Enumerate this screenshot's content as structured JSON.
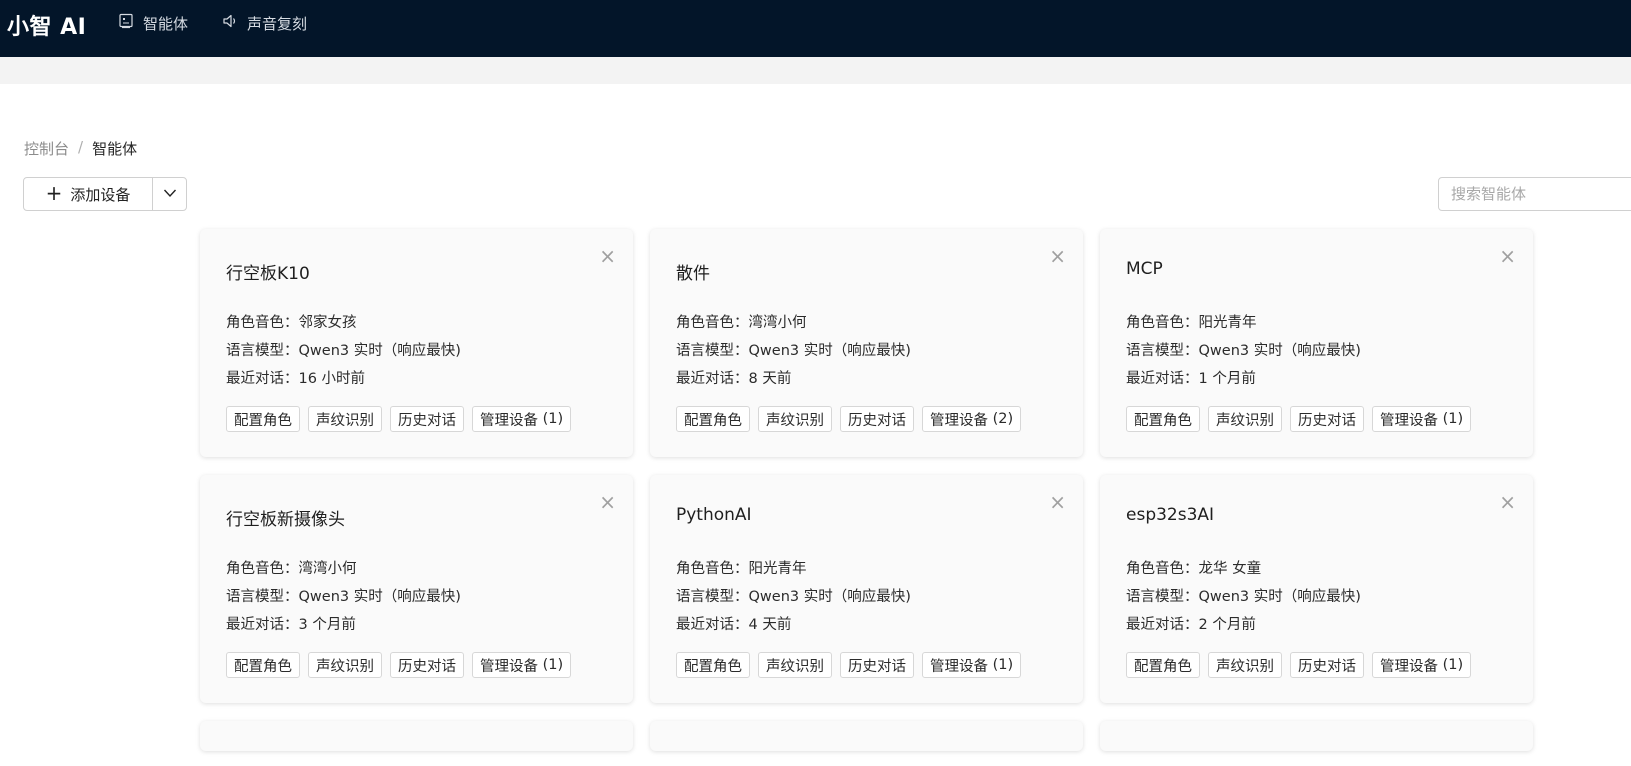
{
  "header": {
    "logo": "小智 AI",
    "nav": [
      {
        "label": "智能体",
        "icon": "robot-icon"
      },
      {
        "label": "声音复刻",
        "icon": "speaker-icon"
      }
    ]
  },
  "breadcrumb": {
    "home": "控制台",
    "separator": "/",
    "current": "智能体"
  },
  "toolbar": {
    "add_label": "添加设备",
    "search_placeholder": "搜索智能体"
  },
  "labels": {
    "voice": "角色音色：",
    "model": "语言模型：",
    "recent": "最近对话：",
    "btn_config": "配置角色",
    "btn_voiceprint": "声纹识别",
    "btn_history": "历史对话",
    "btn_manage": "管理设备"
  },
  "agents": [
    {
      "name": "行空板K10",
      "voice": "邻家女孩",
      "model": "Qwen3 实时（响应最快)",
      "recent": "16 小时前",
      "devices": "(1)"
    },
    {
      "name": "散件",
      "voice": "湾湾小何",
      "model": "Qwen3 实时（响应最快)",
      "recent": "8 天前",
      "devices": "(2)"
    },
    {
      "name": "MCP",
      "voice": "阳光青年",
      "model": "Qwen3 实时（响应最快)",
      "recent": "1 个月前",
      "devices": "(1)"
    },
    {
      "name": "行空板新摄像头",
      "voice": "湾湾小何",
      "model": "Qwen3 实时（响应最快)",
      "recent": "3 个月前",
      "devices": "(1)"
    },
    {
      "name": "PythonAI",
      "voice": "阳光青年",
      "model": "Qwen3 实时（响应最快)",
      "recent": "4 天前",
      "devices": "(1)"
    },
    {
      "name": "esp32s3AI",
      "voice": "龙华 女童",
      "model": "Qwen3 实时（响应最快)",
      "recent": "2 个月前",
      "devices": "(1)"
    }
  ]
}
